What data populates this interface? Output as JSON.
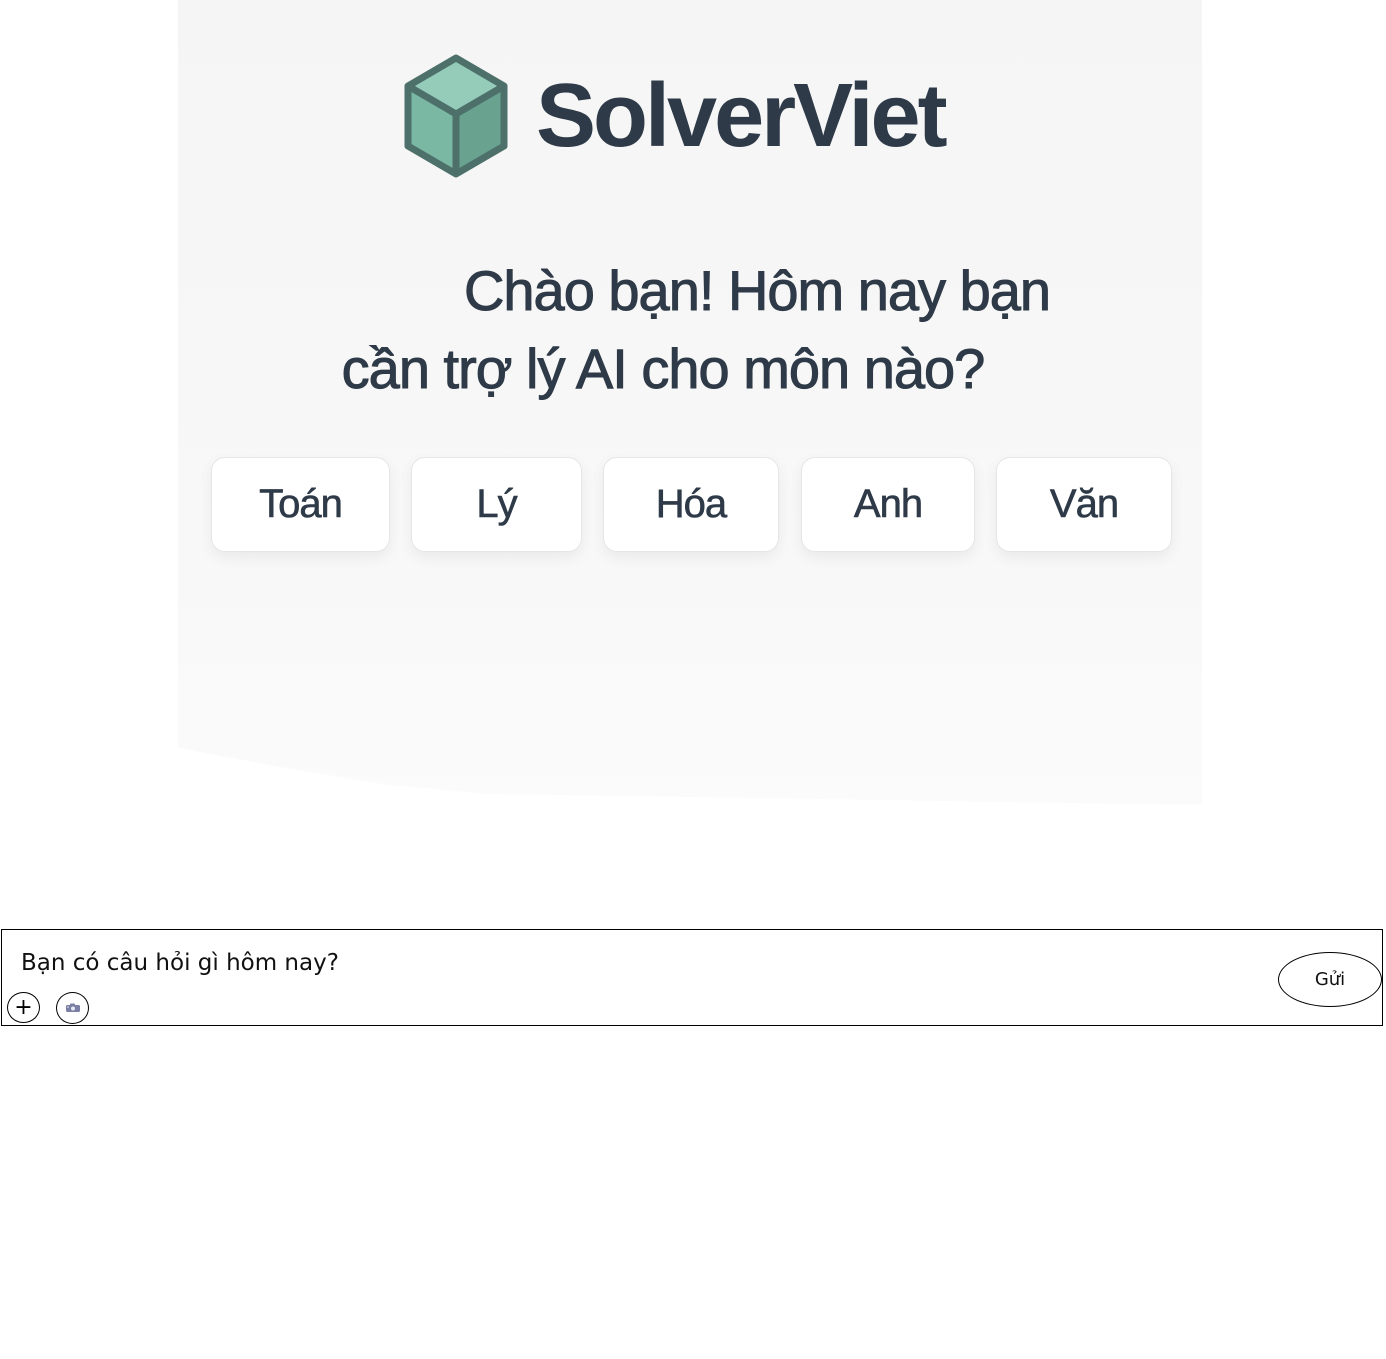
{
  "brand": {
    "name": "SolverViet",
    "logo_icon": "cube-icon",
    "colors": {
      "cube_top": "#95cbb9",
      "cube_left": "#7bb8a3",
      "cube_right": "#6aa290",
      "cube_outline": "#4d716a",
      "text": "#2e3a48"
    }
  },
  "greeting": {
    "line1": "Chào bạn! Hôm nay bạn",
    "line2": "cần trợ lý AI cho môn nào?"
  },
  "subjects": [
    {
      "label": "Toán"
    },
    {
      "label": "Lý"
    },
    {
      "label": "Hóa"
    },
    {
      "label": "Anh"
    },
    {
      "label": "Văn"
    }
  ],
  "composer": {
    "placeholder": "Bạn có câu hỏi gì hôm nay?",
    "attach_label": "+",
    "attach_icon": "plus-icon",
    "camera_icon": "camera-icon",
    "send_label": "Gửi"
  }
}
